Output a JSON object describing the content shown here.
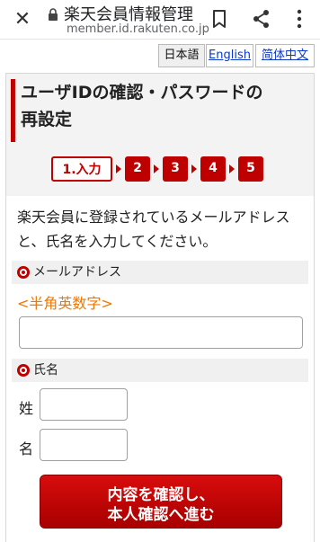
{
  "browser": {
    "title": "楽天会員情報管理",
    "url": "member.id.rakuten.co.jp",
    "icons": {
      "close": "close-icon",
      "lock": "lock-icon",
      "bookmark": "bookmark-icon",
      "share": "share-icon",
      "menu": "more-vert-icon"
    }
  },
  "languages": {
    "japanese": "日本語",
    "english": "English",
    "chinese": "简体中文"
  },
  "page": {
    "heading_line1": "ユーザIDの確認・パスワードの",
    "heading_line2": "再設定",
    "steps": {
      "current": "1.入力",
      "s2": "2",
      "s3": "3",
      "s4": "4",
      "s5": "5"
    },
    "intro": "楽天会員に登録されているメールアドレスと、氏名を入力してください。"
  },
  "form": {
    "email": {
      "label": "メールアドレス",
      "hint": "<半角英数字>",
      "value": "",
      "placeholder": ""
    },
    "name": {
      "label": "氏名",
      "last_label": "姓",
      "first_label": "名",
      "last_value": "",
      "first_value": ""
    },
    "submit_line1": "内容を確認し、",
    "submit_line2": "本人確認へ進む"
  },
  "colors": {
    "accent": "#bf0000",
    "hint": "#f07800",
    "link": "#0a37c8"
  }
}
